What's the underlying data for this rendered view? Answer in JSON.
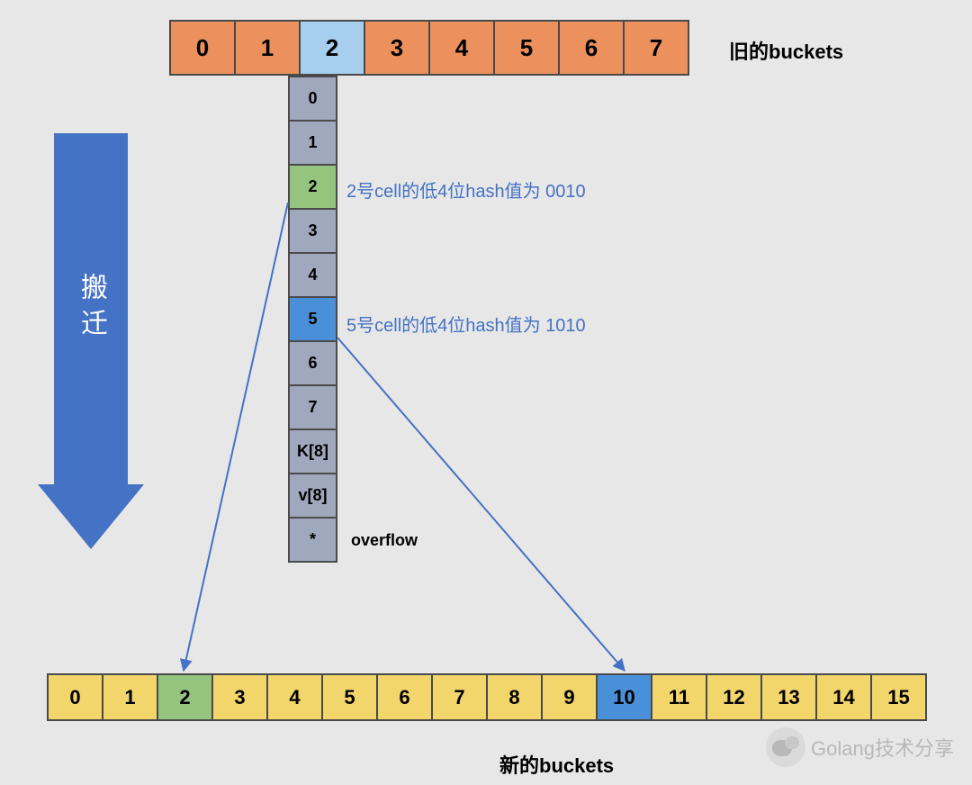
{
  "old_buckets": {
    "label": "旧的buckets",
    "cells": [
      "0",
      "1",
      "2",
      "3",
      "4",
      "5",
      "6",
      "7"
    ],
    "highlight_index": 2
  },
  "bucket_detail": {
    "cells": [
      "0",
      "1",
      "2",
      "3",
      "4",
      "5",
      "6",
      "7",
      "K[8]",
      "v[8]",
      "*"
    ],
    "green_index": 2,
    "blue_index": 5,
    "overflow_label": "overflow"
  },
  "annotations": {
    "cell2": "2号cell的低4位hash值为 0010",
    "cell5": "5号cell的低4位hash值为 1010"
  },
  "migration_arrow_text": "搬迁",
  "new_buckets": {
    "label": "新的buckets",
    "cells": [
      "0",
      "1",
      "2",
      "3",
      "4",
      "5",
      "6",
      "7",
      "8",
      "9",
      "10",
      "11",
      "12",
      "13",
      "14",
      "15"
    ],
    "green_index": 2,
    "blue_index": 10
  },
  "watermark": "Golang技术分享",
  "chart_data": {
    "type": "diagram",
    "description": "Go map rehash/migration: old bucket array of size 8, expanding to new bucket array of size 16. Bucket index 2 in old buckets is detailed showing 8 tophash slots, K[8], v[8], and overflow pointer. Cell 2 (low 4-bit hash 0010) migrates to new bucket 2; cell 5 (low 4-bit hash 1010) migrates to new bucket 10.",
    "old_bucket_count": 8,
    "new_bucket_count": 16,
    "detailed_bucket_index": 2,
    "bucket_slots": [
      "0",
      "1",
      "2",
      "3",
      "4",
      "5",
      "6",
      "7",
      "K[8]",
      "v[8]",
      "*"
    ],
    "migrations": [
      {
        "source_slot": 2,
        "hash_low4": "0010",
        "target_bucket": 2
      },
      {
        "source_slot": 5,
        "hash_low4": "1010",
        "target_bucket": 10
      }
    ],
    "arrow_label": "搬迁"
  }
}
